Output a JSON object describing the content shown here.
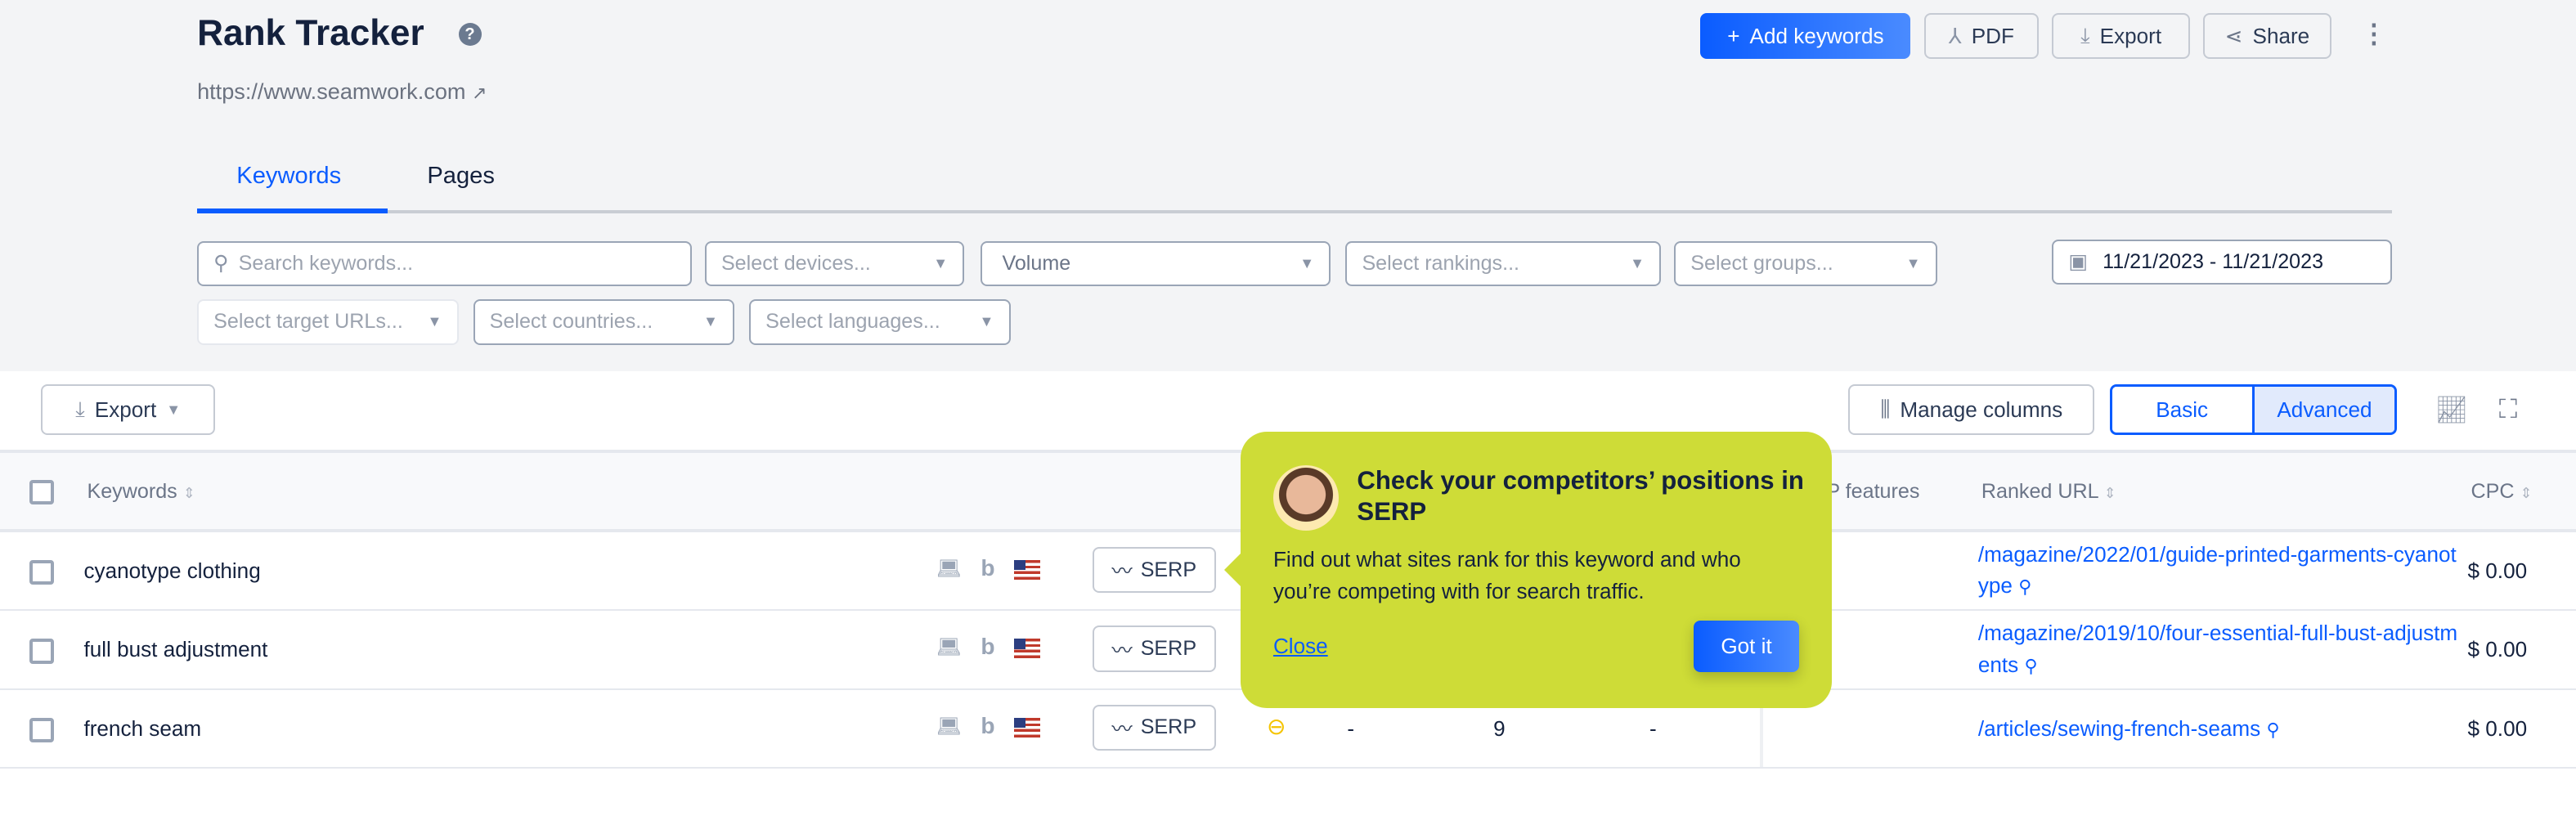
{
  "header": {
    "title": "Rank Tracker",
    "url": "https://www.seamwork.com",
    "add_keywords": "Add keywords",
    "pdf": "PDF",
    "export": "Export",
    "share": "Share"
  },
  "tabs": [
    {
      "label": "Keywords",
      "active": true
    },
    {
      "label": "Pages",
      "active": false
    }
  ],
  "filters": {
    "search_placeholder": "Search keywords...",
    "devices": "Select devices...",
    "volume": "Volume",
    "rankings": "Select rankings...",
    "groups": "Select groups...",
    "date_range": "11/21/2023 - 11/21/2023",
    "target_urls": "Select target URLs...",
    "countries": "Select countries...",
    "languages": "Select languages..."
  },
  "toolbar": {
    "export": "Export",
    "manage_columns": "Manage columns",
    "basic": "Basic",
    "advanced": "Advanced",
    "active_view": "Advanced"
  },
  "table": {
    "headers": {
      "keywords": "Keywords",
      "serp_features": "SERP features",
      "ranked_url": "Ranked URL",
      "cpc": "CPC"
    },
    "serp_label": "SERP",
    "rows": [
      {
        "keyword": "cyanotype clothing",
        "ranked_url": "/magazine/2022/01/guide-printed-garments-cyanotype",
        "cpc": "$ 0.00"
      },
      {
        "keyword": "full bust adjustment",
        "ranked_url": "/magazine/2019/10/four-essential-full-bust-adjustments",
        "cpc": "$ 0.00"
      },
      {
        "keyword": "french seam",
        "ranked_url": "/articles/sewing-french-seams",
        "cpc": "$ 0.00",
        "c1": "-",
        "c2": "9",
        "c3": "-"
      }
    ]
  },
  "popover": {
    "title": "Check your competitors’ positions in SERP",
    "body": "Find out what sites rank for this keyword and who you’re competing with for search traffic.",
    "close": "Close",
    "got_it": "Got it",
    "color": "#cedc37"
  },
  "colors": {
    "accent": "#0a5cff",
    "text": "#14213d"
  }
}
